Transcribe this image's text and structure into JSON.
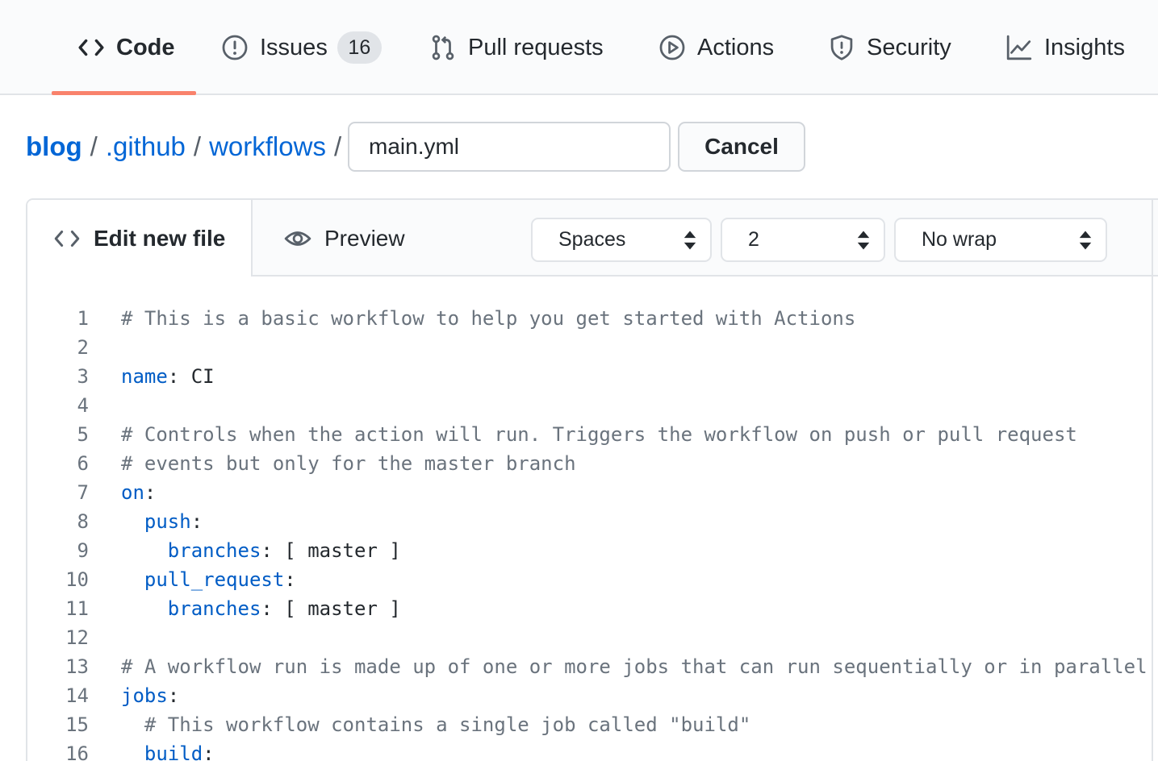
{
  "nav": {
    "tabs": [
      {
        "label": "Code",
        "icon": "code-icon",
        "selected": true
      },
      {
        "label": "Issues",
        "icon": "issue-opened-icon",
        "counter": "16"
      },
      {
        "label": "Pull requests",
        "icon": "git-pull-request-icon"
      },
      {
        "label": "Actions",
        "icon": "play-icon"
      },
      {
        "label": "Security",
        "icon": "shield-icon"
      },
      {
        "label": "Insights",
        "icon": "graph-icon"
      }
    ],
    "underline_color": "#f9826c"
  },
  "breadcrumb": {
    "items": [
      "blog",
      ".github",
      "workflows"
    ],
    "separator": "/"
  },
  "filename_input": {
    "value": "main.yml"
  },
  "cancel_label": "Cancel",
  "editor": {
    "tabs": {
      "edit": "Edit new file",
      "preview": "Preview"
    },
    "selects": {
      "indent_mode": "Spaces",
      "indent_size": "2",
      "wrap_mode": "No wrap"
    },
    "lines": [
      {
        "n": "1",
        "indent": "",
        "kind": "comment",
        "text": "# This is a basic workflow to help you get started with Actions"
      },
      {
        "n": "2",
        "indent": "",
        "kind": "blank",
        "text": ""
      },
      {
        "n": "3",
        "indent": "",
        "kind": "kv",
        "key": "name",
        "sep": ": ",
        "value": "CI"
      },
      {
        "n": "4",
        "indent": "",
        "kind": "blank",
        "text": ""
      },
      {
        "n": "5",
        "indent": "",
        "kind": "comment",
        "text": "# Controls when the action will run. Triggers the workflow on push or pull request"
      },
      {
        "n": "6",
        "indent": "",
        "kind": "comment",
        "text": "# events but only for the master branch"
      },
      {
        "n": "7",
        "indent": "",
        "kind": "kv",
        "key": "on",
        "sep": ":",
        "value": ""
      },
      {
        "n": "8",
        "indent": "  ",
        "kind": "kv",
        "key": "push",
        "sep": ":",
        "value": ""
      },
      {
        "n": "9",
        "indent": "    ",
        "kind": "kv",
        "key": "branches",
        "sep": ": ",
        "value": "[ master ]"
      },
      {
        "n": "10",
        "indent": "  ",
        "kind": "kv",
        "key": "pull_request",
        "sep": ":",
        "value": ""
      },
      {
        "n": "11",
        "indent": "    ",
        "kind": "kv",
        "key": "branches",
        "sep": ": ",
        "value": "[ master ]"
      },
      {
        "n": "12",
        "indent": "",
        "kind": "blank",
        "text": ""
      },
      {
        "n": "13",
        "indent": "",
        "kind": "comment",
        "text": "# A workflow run is made up of one or more jobs that can run sequentially or in parallel"
      },
      {
        "n": "14",
        "indent": "",
        "kind": "kv",
        "key": "jobs",
        "sep": ":",
        "value": ""
      },
      {
        "n": "15",
        "indent": "  ",
        "kind": "comment",
        "text": "# This workflow contains a single job called \"build\""
      },
      {
        "n": "16",
        "indent": "  ",
        "kind": "kv",
        "key": "build",
        "sep": ":",
        "value": ""
      }
    ]
  },
  "colors": {
    "link": "#0366d6",
    "yaml_key": "#005cc5",
    "comment": "#6a737d",
    "text": "#24292e"
  }
}
